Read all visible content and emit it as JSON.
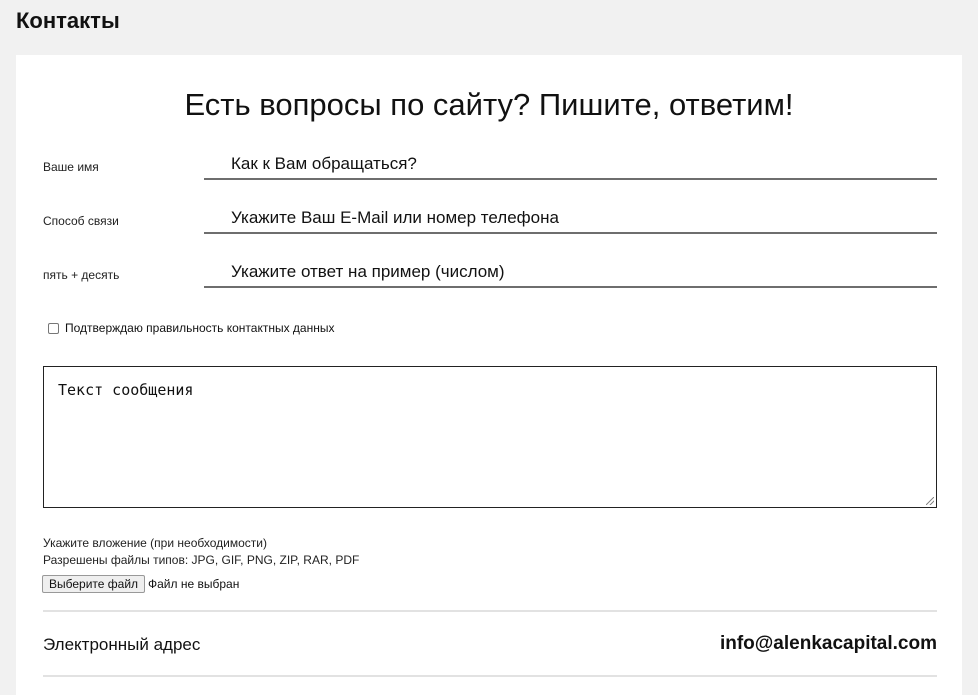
{
  "page_title": "Контакты",
  "form": {
    "heading": "Есть вопросы по сайту? Пишите, ответим!",
    "fields": [
      {
        "label": "Ваше имя",
        "placeholder": "Как к Вам обращаться?"
      },
      {
        "label": "Способ связи",
        "placeholder": "Укажите Ваш E-Mail или номер телефона"
      },
      {
        "label": "пять + десять",
        "placeholder": "Укажите ответ на пример (числом)"
      }
    ],
    "confirm_label": "Подтверждаю правильность контактных данных",
    "message_placeholder": "Текст сообщения",
    "attach_note": "Укажите вложение (при необходимости)",
    "allowed_types": "Разрешены файлы типов: JPG, GIF, PNG, ZIP, RAR, PDF",
    "file_button": "Выберите файл",
    "file_status": "Файл не выбран"
  },
  "contacts": {
    "email_label": "Электронный адрес",
    "email_value": "info@alenkacapital.com"
  }
}
